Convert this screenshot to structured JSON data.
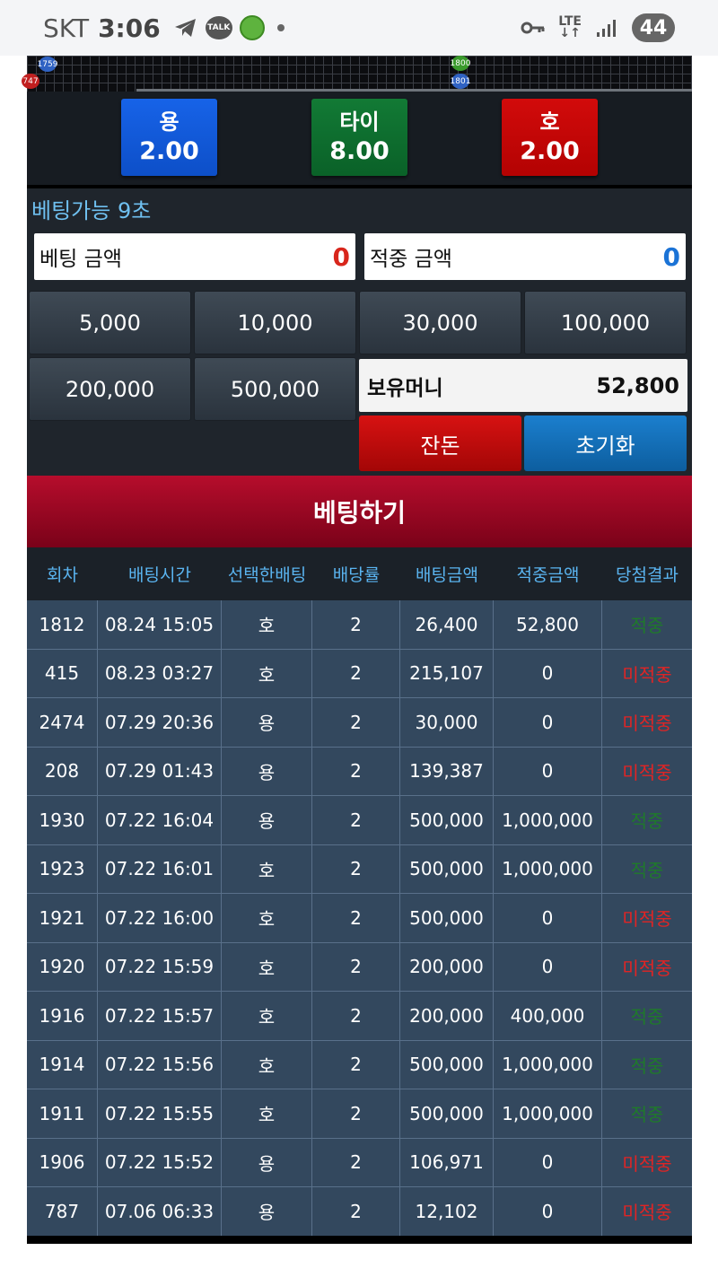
{
  "status_bar": {
    "carrier": "SKT",
    "time": "3:06",
    "talk_label": "TALK",
    "network": "LTE",
    "battery": "44"
  },
  "road": {
    "beads": [
      {
        "label": "1759",
        "color": "blue"
      },
      {
        "label": "747",
        "color": "red"
      },
      {
        "label": "1800",
        "color": "green"
      },
      {
        "label": "1801",
        "color": "blue"
      }
    ]
  },
  "odds": [
    {
      "name": "용",
      "value": "2.00"
    },
    {
      "name": "타이",
      "value": "8.00"
    },
    {
      "name": "호",
      "value": "2.00"
    }
  ],
  "bet_status": "베팅가능 9초",
  "bet_amount": {
    "label": "베팅 금액",
    "value": "0"
  },
  "win_amount": {
    "label": "적중 금액",
    "value": "0"
  },
  "chips": [
    "5,000",
    "10,000",
    "30,000",
    "100,000",
    "200,000",
    "500,000"
  ],
  "balance": {
    "label": "보유머니",
    "value": "52,800"
  },
  "buttons": {
    "change": "잔돈",
    "reset": "초기화",
    "bet": "베팅하기"
  },
  "table": {
    "headers": [
      "회차",
      "배팅시간",
      "선택한배팅",
      "배당률",
      "배팅금액",
      "적중금액",
      "당첨결과"
    ],
    "rows": [
      [
        "1812",
        "08.24 15:05",
        "호",
        "2",
        "26,400",
        "52,800",
        "적중"
      ],
      [
        "415",
        "08.23 03:27",
        "호",
        "2",
        "215,107",
        "0",
        "미적중"
      ],
      [
        "2474",
        "07.29 20:36",
        "용",
        "2",
        "30,000",
        "0",
        "미적중"
      ],
      [
        "208",
        "07.29 01:43",
        "용",
        "2",
        "139,387",
        "0",
        "미적중"
      ],
      [
        "1930",
        "07.22 16:04",
        "용",
        "2",
        "500,000",
        "1,000,000",
        "적중"
      ],
      [
        "1923",
        "07.22 16:01",
        "호",
        "2",
        "500,000",
        "1,000,000",
        "적중"
      ],
      [
        "1921",
        "07.22 16:00",
        "호",
        "2",
        "500,000",
        "0",
        "미적중"
      ],
      [
        "1920",
        "07.22 15:59",
        "호",
        "2",
        "200,000",
        "0",
        "미적중"
      ],
      [
        "1916",
        "07.22 15:57",
        "호",
        "2",
        "200,000",
        "400,000",
        "적중"
      ],
      [
        "1914",
        "07.22 15:56",
        "호",
        "2",
        "500,000",
        "1,000,000",
        "적중"
      ],
      [
        "1911",
        "07.22 15:55",
        "호",
        "2",
        "500,000",
        "1,000,000",
        "적중"
      ],
      [
        "1906",
        "07.22 15:52",
        "용",
        "2",
        "106,971",
        "0",
        "미적중"
      ],
      [
        "787",
        "07.06 06:33",
        "용",
        "2",
        "12,102",
        "0",
        "미적중"
      ]
    ]
  },
  "colors": {
    "dragon": "#1763e8",
    "tie": "#127a35",
    "tiger": "#d20b0b",
    "bet_button": "#b60d2c",
    "win": "#1f7a2a",
    "lose": "#e12424"
  }
}
